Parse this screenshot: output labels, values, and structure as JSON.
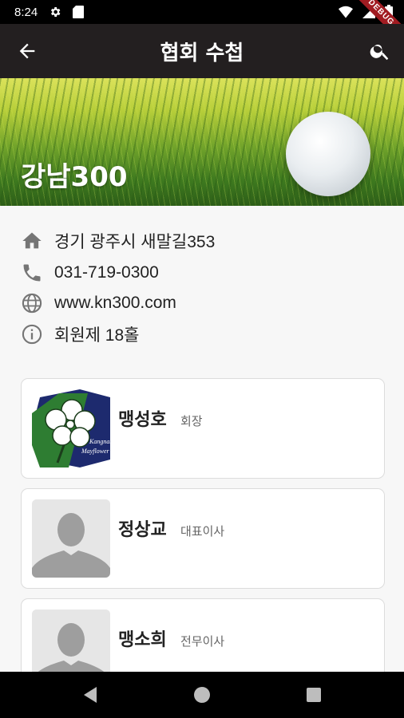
{
  "status_bar": {
    "time": "8:24",
    "debug_label": "DEBUG"
  },
  "app_bar": {
    "title": "협회 수첩"
  },
  "club": {
    "name": "강남300",
    "address": "경기 광주시 새말길353",
    "phone": "031-719-0300",
    "website": "www.kn300.com",
    "membership": "회원제 18홀"
  },
  "members": [
    {
      "name": "맹성호",
      "role": "회장",
      "photo": "club-logo",
      "logo_text_1": "Kangnam",
      "logo_text_2": "Mayflower"
    },
    {
      "name": "정상교",
      "role": "대표이사",
      "photo": "person-placeholder"
    },
    {
      "name": "맹소희",
      "role": "전무이사",
      "photo": "person-placeholder"
    }
  ],
  "colors": {
    "app_bar": "#231f20",
    "status_bar": "#000000",
    "background": "#f7f7f7",
    "icon_gray": "#757575"
  }
}
